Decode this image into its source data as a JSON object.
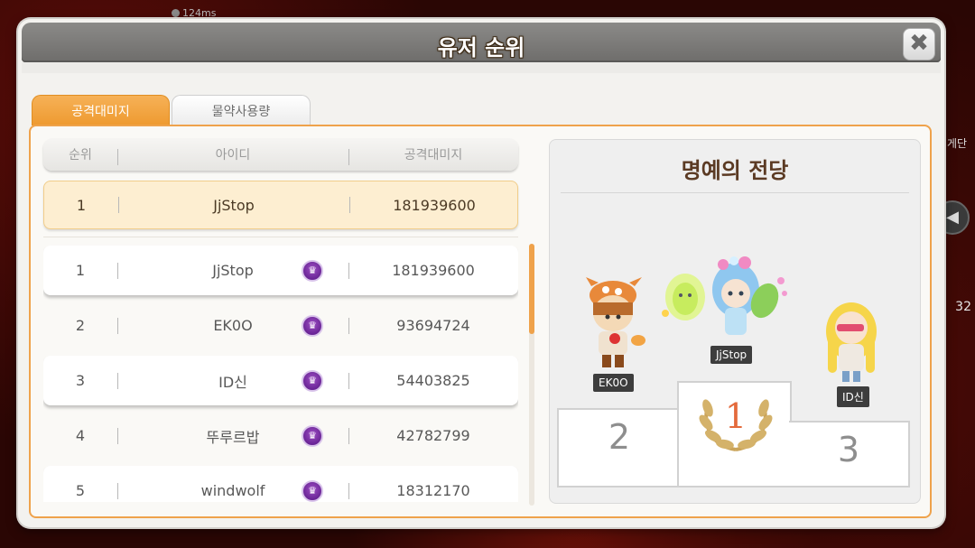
{
  "background": {
    "ping": "124ms",
    "side_label": "게단",
    "side_number": "32"
  },
  "window": {
    "title": "유저 순위"
  },
  "tabs": [
    {
      "label": "공격대미지",
      "active": true
    },
    {
      "label": "물약사용량",
      "active": false
    }
  ],
  "table": {
    "headers": {
      "rank": "순위",
      "id": "아이디",
      "damage": "공격대미지"
    },
    "my_row": {
      "rank": "1",
      "id": "JjStop",
      "damage": "181939600"
    },
    "rows": [
      {
        "rank": "1",
        "id": "JjStop",
        "damage": "181939600"
      },
      {
        "rank": "2",
        "id": "EK0O",
        "damage": "93694724"
      },
      {
        "rank": "3",
        "id": "ID신",
        "damage": "54403825"
      },
      {
        "rank": "4",
        "id": "뚜루르밥",
        "damage": "42782799"
      },
      {
        "rank": "5",
        "id": "windwolf",
        "damage": "18312170"
      }
    ]
  },
  "hall_of_fame": {
    "title": "명예의 전당",
    "first": {
      "name": "JjStop",
      "place": "1"
    },
    "second": {
      "name": "EK0O",
      "place": "2"
    },
    "third": {
      "name": "ID신",
      "place": "3"
    }
  },
  "colors": {
    "accent": "#efa24b",
    "medal": "#6a2596",
    "highlight_row": "#fdeed1"
  }
}
